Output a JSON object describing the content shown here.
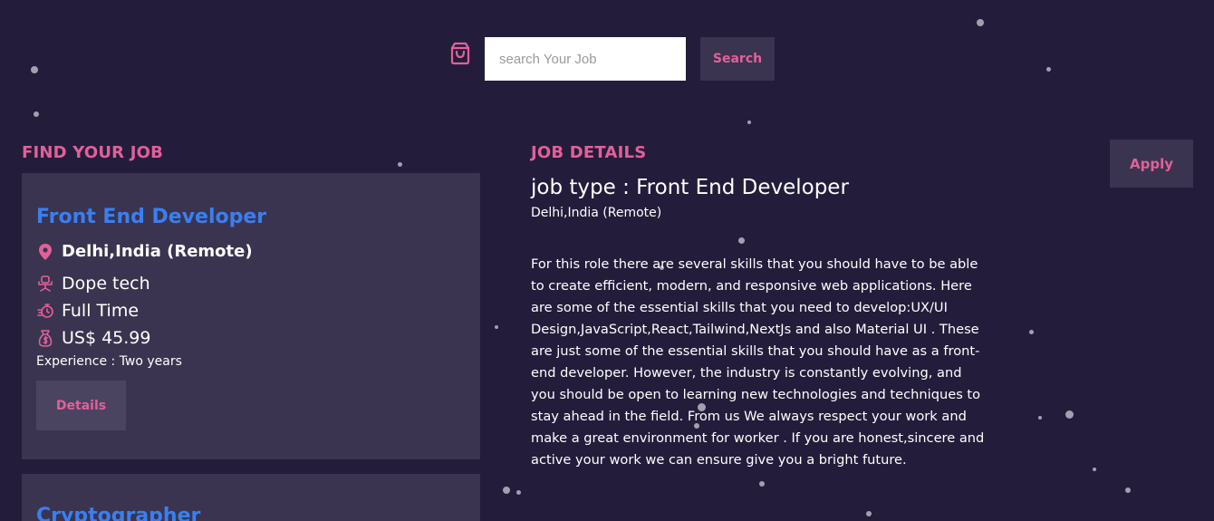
{
  "search": {
    "placeholder": "search Your Job",
    "button_label": "Search",
    "icon": "shopping-bag-icon"
  },
  "find_section": {
    "heading": "FIND YOUR JOB",
    "jobs": [
      {
        "title": "Front End Developer",
        "location": "Delhi,India (Remote)",
        "company": "Dope tech",
        "job_type": "Full Time",
        "salary": "US$ 45.99",
        "experience": "Experience : Two years",
        "details_label": "Details",
        "icons": [
          "location-pin-icon",
          "office-chair-icon",
          "stopwatch-icon",
          "money-icon"
        ]
      },
      {
        "title": "Cryptographer"
      }
    ]
  },
  "details_section": {
    "heading": "JOB DETAILS",
    "job_type": "job type : Front End Developer",
    "location": "Delhi,India (Remote)",
    "description": "For this role there are several skills that you should have to be able to create efficient, modern, and responsive web applications. Here are some of the essential skills that you need to develop:UX/UI Design,JavaScript,React,Tailwind,NextJs and also Material UI . These are just some of the essential skills that you should have as a front-end developer. However, the industry is constantly evolving, and you should be open to learning new technologies and techniques to stay ahead in the field. From us We always respect your work and make a great environment for worker . If you are honest,sincere and active your work we can ensure give you a bright future.",
    "apply_label": "Apply"
  },
  "colors": {
    "background": "#231d3b",
    "card": "#3a3450",
    "accent": "#e2609a",
    "job_title": "#3a7ff0"
  }
}
